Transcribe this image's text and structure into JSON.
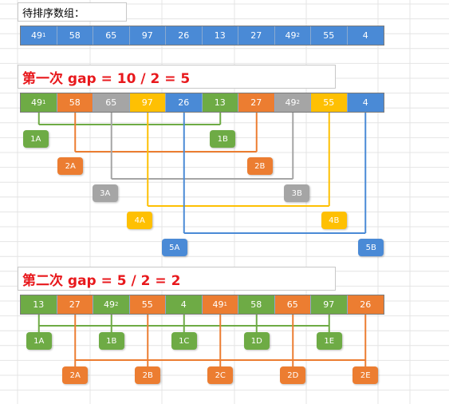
{
  "title": "待排序数组：",
  "colors": {
    "blue": "#4a8ad6",
    "green": "#6eab45",
    "orange": "#ec7d31",
    "gray": "#a5a5a5",
    "yellow": "#fec003"
  },
  "rows": [
    {
      "id": "row0",
      "cells": [
        {
          "value": "49",
          "sup": "1",
          "color": "blue"
        },
        {
          "value": "58",
          "sup": "",
          "color": "blue"
        },
        {
          "value": "65",
          "sup": "",
          "color": "blue"
        },
        {
          "value": "97",
          "sup": "",
          "color": "blue"
        },
        {
          "value": "26",
          "sup": "",
          "color": "blue"
        },
        {
          "value": "13",
          "sup": "",
          "color": "blue"
        },
        {
          "value": "27",
          "sup": "",
          "color": "blue"
        },
        {
          "value": "49",
          "sup": "2",
          "color": "blue"
        },
        {
          "value": "55",
          "sup": "",
          "color": "blue"
        },
        {
          "value": "4",
          "sup": "",
          "color": "blue"
        }
      ]
    },
    {
      "id": "row1",
      "cells": [
        {
          "value": "49",
          "sup": "1",
          "color": "green"
        },
        {
          "value": "58",
          "sup": "",
          "color": "orange"
        },
        {
          "value": "65",
          "sup": "",
          "color": "gray"
        },
        {
          "value": "97",
          "sup": "",
          "color": "yellow"
        },
        {
          "value": "26",
          "sup": "",
          "color": "blue"
        },
        {
          "value": "13",
          "sup": "",
          "color": "green"
        },
        {
          "value": "27",
          "sup": "",
          "color": "orange"
        },
        {
          "value": "49",
          "sup": "2",
          "color": "gray"
        },
        {
          "value": "55",
          "sup": "",
          "color": "yellow"
        },
        {
          "value": "4",
          "sup": "",
          "color": "blue"
        }
      ]
    },
    {
      "id": "row2",
      "cells": [
        {
          "value": "13",
          "sup": "",
          "color": "green"
        },
        {
          "value": "27",
          "sup": "",
          "color": "orange"
        },
        {
          "value": "49",
          "sup": "2",
          "color": "green"
        },
        {
          "value": "55",
          "sup": "",
          "color": "orange"
        },
        {
          "value": "4",
          "sup": "",
          "color": "green"
        },
        {
          "value": "49",
          "sup": "1",
          "color": "orange"
        },
        {
          "value": "58",
          "sup": "",
          "color": "green"
        },
        {
          "value": "65",
          "sup": "",
          "color": "orange"
        },
        {
          "value": "97",
          "sup": "",
          "color": "green"
        },
        {
          "value": "26",
          "sup": "",
          "color": "orange"
        }
      ]
    }
  ],
  "pass1": {
    "title": "第一次 gap = 10 / 2 = 5",
    "groups": [
      {
        "color": "green",
        "members": [
          0,
          5
        ],
        "labels": [
          "1A",
          "1B"
        ]
      },
      {
        "color": "orange",
        "members": [
          1,
          6
        ],
        "labels": [
          "2A",
          "2B"
        ]
      },
      {
        "color": "gray",
        "members": [
          2,
          7
        ],
        "labels": [
          "3A",
          "3B"
        ]
      },
      {
        "color": "yellow",
        "members": [
          3,
          8
        ],
        "labels": [
          "4A",
          "4B"
        ]
      },
      {
        "color": "blue",
        "members": [
          4,
          9
        ],
        "labels": [
          "5A",
          "5B"
        ]
      }
    ]
  },
  "pass2": {
    "title": "第二次 gap = 5 / 2 = 2",
    "groups": [
      {
        "color": "green",
        "members": [
          0,
          2,
          4,
          6,
          8
        ],
        "labels": [
          "1A",
          "1B",
          "1C",
          "1D",
          "1E"
        ]
      },
      {
        "color": "orange",
        "members": [
          1,
          3,
          5,
          7,
          9
        ],
        "labels": [
          "2A",
          "2B",
          "2C",
          "2D",
          "2E"
        ]
      }
    ]
  }
}
